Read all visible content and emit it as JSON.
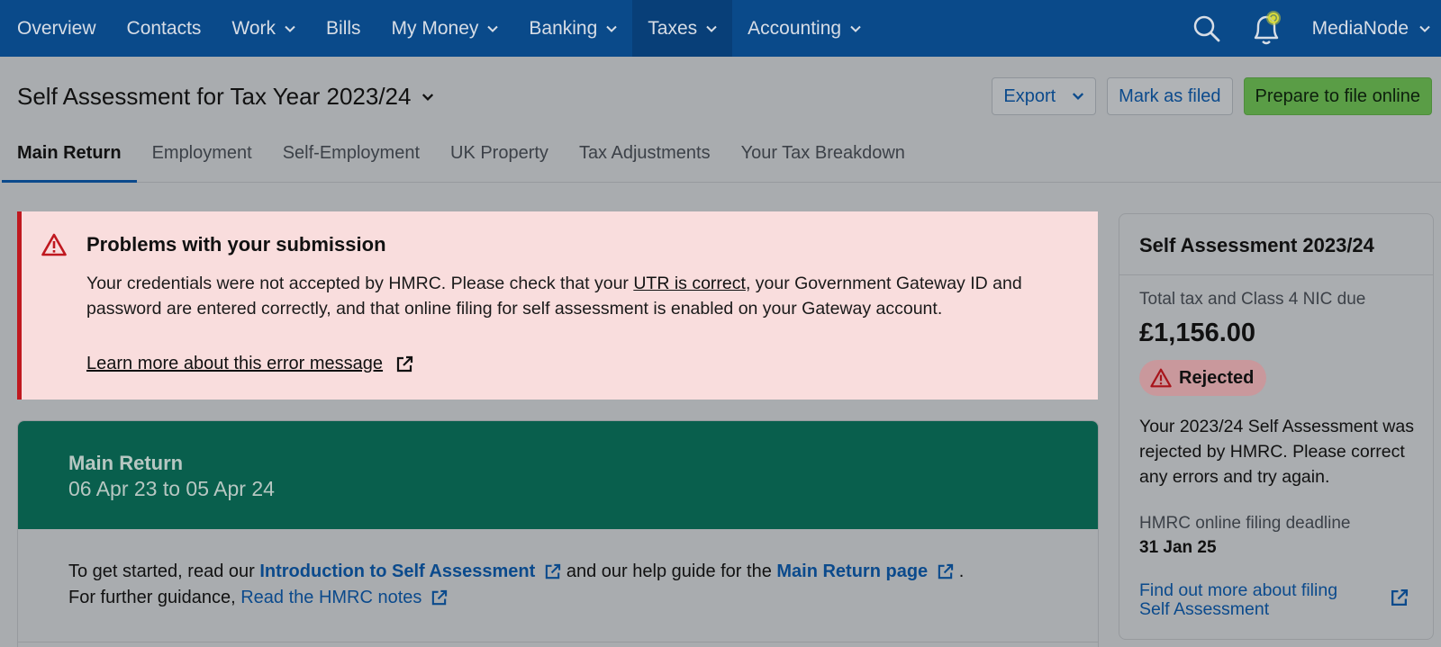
{
  "nav": {
    "items": [
      {
        "label": "Overview"
      },
      {
        "label": "Contacts"
      },
      {
        "label": "Work"
      },
      {
        "label": "Bills"
      },
      {
        "label": "My Money"
      },
      {
        "label": "Banking"
      },
      {
        "label": "Taxes"
      },
      {
        "label": "Accounting"
      }
    ],
    "org_name": "MediaNode",
    "colors": {
      "bar": "#0a4a8a",
      "active": "#083f78"
    }
  },
  "header": {
    "title": "Self Assessment for Tax Year 2023/24",
    "export_label": "Export",
    "mark_filed_label": "Mark as filed",
    "prepare_label": "Prepare to file online"
  },
  "tabs": [
    {
      "label": "Main Return"
    },
    {
      "label": "Employment"
    },
    {
      "label": "Self-Employment"
    },
    {
      "label": "UK Property"
    },
    {
      "label": "Tax Adjustments"
    },
    {
      "label": "Your Tax Breakdown"
    }
  ],
  "error": {
    "title": "Problems with your submission",
    "text_before": "Your credentials were not accepted by HMRC. Please check that your ",
    "utr_link": "UTR is correct",
    "text_after": ", your Government Gateway ID and password are entered correctly, and that online filing for self assessment is enabled on your Gateway account.",
    "learn_more": "Learn more about this error message"
  },
  "main_card": {
    "title": "Main Return",
    "period": "06 Apr 23 to 05 Apr 24",
    "intro_1": "To get started, read our ",
    "intro_link": "Introduction to Self Assessment",
    "intro_2": " and our help guide for the ",
    "main_return_link": "Main Return page",
    "intro_3": " .",
    "guidance": "For further guidance, ",
    "hmrc_link": "Read the HMRC notes"
  },
  "side": {
    "title": "Self Assessment 2023/24",
    "tax_label": "Total tax and Class 4 NIC due",
    "amount": "£1,156.00",
    "status": "Rejected",
    "message": "Your 2023/24 Self Assessment was rejected by HMRC. Please correct any errors and try again.",
    "deadline_label": "HMRC online filing deadline",
    "deadline": "31 Jan 25",
    "more_link": "Find out more about filing Self Assessment"
  }
}
